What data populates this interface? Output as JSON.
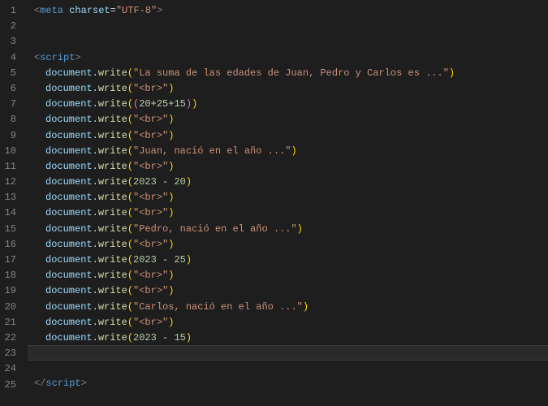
{
  "activeLine": 23,
  "lines": [
    {
      "n": 1,
      "indent": 1,
      "tokens": [
        [
          "tag",
          "<"
        ],
        [
          "elem",
          "meta"
        ],
        [
          "punc",
          " "
        ],
        [
          "attr",
          "charset"
        ],
        [
          "punc",
          "="
        ],
        [
          "str",
          "\"UTF-8\""
        ],
        [
          "tag",
          ">"
        ]
      ]
    },
    {
      "n": 2,
      "indent": 1,
      "tokens": []
    },
    {
      "n": 3,
      "indent": 1,
      "tokens": []
    },
    {
      "n": 4,
      "indent": 1,
      "tokens": [
        [
          "tag",
          "<"
        ],
        [
          "elem",
          "script"
        ],
        [
          "tag",
          ">"
        ]
      ]
    },
    {
      "n": 5,
      "indent": 2,
      "tokens": [
        [
          "obj",
          "document"
        ],
        [
          "punc",
          "."
        ],
        [
          "func",
          "write"
        ],
        [
          "paren",
          "("
        ],
        [
          "str",
          "\"La suma de las edades de Juan, Pedro y Carlos es ...\""
        ],
        [
          "paren",
          ")"
        ]
      ]
    },
    {
      "n": 6,
      "indent": 2,
      "tokens": [
        [
          "obj",
          "document"
        ],
        [
          "punc",
          "."
        ],
        [
          "func",
          "write"
        ],
        [
          "paren",
          "("
        ],
        [
          "str",
          "\"<br>\""
        ],
        [
          "paren",
          ")"
        ]
      ]
    },
    {
      "n": 7,
      "indent": 2,
      "tokens": [
        [
          "obj",
          "document"
        ],
        [
          "punc",
          "."
        ],
        [
          "func",
          "write"
        ],
        [
          "paren",
          "("
        ],
        [
          "paren2",
          "("
        ],
        [
          "num",
          "20"
        ],
        [
          "op",
          "+"
        ],
        [
          "num",
          "25"
        ],
        [
          "op",
          "+"
        ],
        [
          "num",
          "15"
        ],
        [
          "paren2",
          ")"
        ],
        [
          "paren",
          ")"
        ]
      ]
    },
    {
      "n": 8,
      "indent": 2,
      "tokens": [
        [
          "obj",
          "document"
        ],
        [
          "punc",
          "."
        ],
        [
          "func",
          "write"
        ],
        [
          "paren",
          "("
        ],
        [
          "str",
          "\"<br>\""
        ],
        [
          "paren",
          ")"
        ]
      ]
    },
    {
      "n": 9,
      "indent": 2,
      "tokens": [
        [
          "obj",
          "document"
        ],
        [
          "punc",
          "."
        ],
        [
          "func",
          "write"
        ],
        [
          "paren",
          "("
        ],
        [
          "str",
          "\"<br>\""
        ],
        [
          "paren",
          ")"
        ]
      ]
    },
    {
      "n": 10,
      "indent": 2,
      "tokens": [
        [
          "obj",
          "document"
        ],
        [
          "punc",
          "."
        ],
        [
          "func",
          "write"
        ],
        [
          "paren",
          "("
        ],
        [
          "str",
          "\"Juan, nació en el año ...\""
        ],
        [
          "paren",
          ")"
        ]
      ]
    },
    {
      "n": 11,
      "indent": 2,
      "tokens": [
        [
          "obj",
          "document"
        ],
        [
          "punc",
          "."
        ],
        [
          "func",
          "write"
        ],
        [
          "paren",
          "("
        ],
        [
          "str",
          "\"<br>\""
        ],
        [
          "paren",
          ")"
        ]
      ]
    },
    {
      "n": 12,
      "indent": 2,
      "tokens": [
        [
          "obj",
          "document"
        ],
        [
          "punc",
          "."
        ],
        [
          "func",
          "write"
        ],
        [
          "paren",
          "("
        ],
        [
          "num",
          "2023"
        ],
        [
          "op",
          " - "
        ],
        [
          "num",
          "20"
        ],
        [
          "paren",
          ")"
        ]
      ]
    },
    {
      "n": 13,
      "indent": 2,
      "tokens": [
        [
          "obj",
          "document"
        ],
        [
          "punc",
          "."
        ],
        [
          "func",
          "write"
        ],
        [
          "paren",
          "("
        ],
        [
          "str",
          "\"<br>\""
        ],
        [
          "paren",
          ")"
        ]
      ]
    },
    {
      "n": 14,
      "indent": 2,
      "tokens": [
        [
          "obj",
          "document"
        ],
        [
          "punc",
          "."
        ],
        [
          "func",
          "write"
        ],
        [
          "paren",
          "("
        ],
        [
          "str",
          "\"<br>\""
        ],
        [
          "paren",
          ")"
        ]
      ]
    },
    {
      "n": 15,
      "indent": 2,
      "tokens": [
        [
          "obj",
          "document"
        ],
        [
          "punc",
          "."
        ],
        [
          "func",
          "write"
        ],
        [
          "paren",
          "("
        ],
        [
          "str",
          "\"Pedro, nació en el año ...\""
        ],
        [
          "paren",
          ")"
        ]
      ]
    },
    {
      "n": 16,
      "indent": 2,
      "tokens": [
        [
          "obj",
          "document"
        ],
        [
          "punc",
          "."
        ],
        [
          "func",
          "write"
        ],
        [
          "paren",
          "("
        ],
        [
          "str",
          "\"<br>\""
        ],
        [
          "paren",
          ")"
        ]
      ]
    },
    {
      "n": 17,
      "indent": 2,
      "tokens": [
        [
          "obj",
          "document"
        ],
        [
          "punc",
          "."
        ],
        [
          "func",
          "write"
        ],
        [
          "paren",
          "("
        ],
        [
          "num",
          "2023"
        ],
        [
          "op",
          " - "
        ],
        [
          "num",
          "25"
        ],
        [
          "paren",
          ")"
        ]
      ]
    },
    {
      "n": 18,
      "indent": 2,
      "tokens": [
        [
          "obj",
          "document"
        ],
        [
          "punc",
          "."
        ],
        [
          "func",
          "write"
        ],
        [
          "paren",
          "("
        ],
        [
          "str",
          "\"<br>\""
        ],
        [
          "paren",
          ")"
        ]
      ]
    },
    {
      "n": 19,
      "indent": 2,
      "tokens": [
        [
          "obj",
          "document"
        ],
        [
          "punc",
          "."
        ],
        [
          "func",
          "write"
        ],
        [
          "paren",
          "("
        ],
        [
          "str",
          "\"<br>\""
        ],
        [
          "paren",
          ")"
        ]
      ]
    },
    {
      "n": 20,
      "indent": 2,
      "tokens": [
        [
          "obj",
          "document"
        ],
        [
          "punc",
          "."
        ],
        [
          "func",
          "write"
        ],
        [
          "paren",
          "("
        ],
        [
          "str",
          "\"Carlos, nació en el año ...\""
        ],
        [
          "paren",
          ")"
        ]
      ]
    },
    {
      "n": 21,
      "indent": 2,
      "tokens": [
        [
          "obj",
          "document"
        ],
        [
          "punc",
          "."
        ],
        [
          "func",
          "write"
        ],
        [
          "paren",
          "("
        ],
        [
          "str",
          "\"<br>\""
        ],
        [
          "paren",
          ")"
        ]
      ]
    },
    {
      "n": 22,
      "indent": 2,
      "tokens": [
        [
          "obj",
          "document"
        ],
        [
          "punc",
          "."
        ],
        [
          "func",
          "write"
        ],
        [
          "paren",
          "("
        ],
        [
          "num",
          "2023"
        ],
        [
          "op",
          " - "
        ],
        [
          "num",
          "15"
        ],
        [
          "paren",
          ")"
        ]
      ]
    },
    {
      "n": 23,
      "indent": 2,
      "tokens": []
    },
    {
      "n": 24,
      "indent": 1,
      "tokens": []
    },
    {
      "n": 25,
      "indent": 1,
      "tokens": [
        [
          "tag",
          "</"
        ],
        [
          "elem",
          "script"
        ],
        [
          "tag",
          ">"
        ]
      ]
    }
  ]
}
